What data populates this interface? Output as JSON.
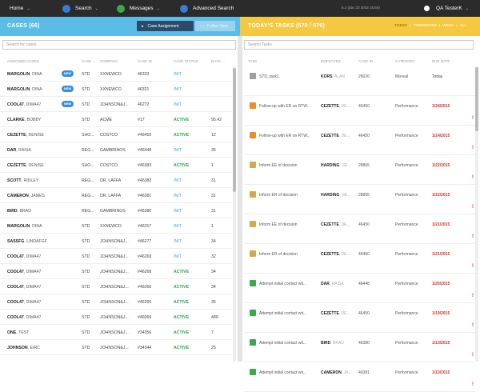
{
  "nav": {
    "home": "Home",
    "search": "Search",
    "messages": "Messages",
    "advanced": "Advanced Search",
    "version": "5.1 (abc 23 2015 15:50)",
    "user": "QA TesterK"
  },
  "cases": {
    "title": "CASES (66)",
    "assign_btn": "Case Assignment",
    "folder_btn": "Folder View",
    "search_placeholder": "Search for cases",
    "headers": [
      "ASSIGNED CASES",
      "CASE ...",
      "COMPANY",
      "CASE ID",
      "CASE STATUS",
      "DAYS ..."
    ],
    "rows": [
      {
        "last": "MARGOLIN",
        "first": ", DINA",
        "badge": "NEW",
        "type": "STD",
        "company": "XXNEWCO",
        "id": "46323",
        "status": "INIT",
        "days": ""
      },
      {
        "last": "MARGOLIN",
        "first": ", DINA",
        "badge": "NEW",
        "type": "STD",
        "company": "XXNEWCO",
        "id": "46321",
        "status": "INIT",
        "days": ""
      },
      {
        "last": "COOL47",
        "first": ", DIMA47",
        "badge": "NEW",
        "type": "STD",
        "company": "JOHNSON&J...",
        "id": "46272",
        "status": "INIT",
        "days": ""
      },
      {
        "last": "CLARKE",
        "first": ", BOBBY",
        "badge": "",
        "type": "STD",
        "company": "ACME",
        "id": "#17",
        "status": "ACTIVE",
        "days": "95.42"
      },
      {
        "last": "CEZETTE",
        "first": ", DENISE",
        "badge": "",
        "type": "SHO...",
        "company": "COSTCO",
        "id": "#46450",
        "status": "ACTIVE",
        "days": "12"
      },
      {
        "last": "DAR",
        "first": ", RAISA",
        "badge": "",
        "type": "REG...",
        "company": "GAMBRINOS",
        "id": "#46448",
        "status": "INIT",
        "days": "35"
      },
      {
        "last": "CEZETTE",
        "first": ", DENISE",
        "badge": "",
        "type": "SHO...",
        "company": "COSTCO",
        "id": "#46383",
        "status": "ACTIVE",
        "days": "1"
      },
      {
        "last": "SCOTT",
        "first": ", RIDLEY",
        "badge": "",
        "type": "REG...",
        "company": "DR. LAFFA",
        "id": "#46382",
        "status": "INIT",
        "days": "31"
      },
      {
        "last": "CAMERON",
        "first": ", JAMES",
        "badge": "",
        "type": "REG...",
        "company": "DR. LAFFA",
        "id": "#46381",
        "status": "INIT",
        "days": "31"
      },
      {
        "last": "BIRD",
        "first": ", BRAD",
        "badge": "",
        "type": "REG...",
        "company": "GAMBRINOS",
        "id": "#46380",
        "status": "INIT",
        "days": "31"
      },
      {
        "last": "MARGOLIN",
        "first": ", DINA",
        "badge": "",
        "type": "STD",
        "company": "XXNEWCO",
        "id": "#46317",
        "status": "INIT",
        "days": "1"
      },
      {
        "last": "SASSFG",
        "first": ", LINDAFGF",
        "badge": "",
        "type": "STD",
        "company": "JOHNSON&J...",
        "id": "#46277",
        "status": "INIT",
        "days": "34"
      },
      {
        "last": "COOL47",
        "first": ", DIMA47",
        "badge": "",
        "type": "STD",
        "company": "JOHNSON&J...",
        "id": "#46269",
        "status": "INIT",
        "days": "32"
      },
      {
        "last": "COOL47",
        "first": ", DIMA47",
        "badge": "",
        "type": "STD",
        "company": "JOHNSON&J...",
        "id": "#46268",
        "status": "ACTIVE",
        "days": "34"
      },
      {
        "last": "COOL47",
        "first": ", DIMA47",
        "badge": "",
        "type": "STD",
        "company": "JOHNSON&J...",
        "id": "#46266",
        "status": "ACTIVE",
        "days": "34"
      },
      {
        "last": "COOL47",
        "first": ", DIMA47",
        "badge": "",
        "type": "STD",
        "company": "JOHNSON&J...",
        "id": "#46265",
        "status": "ACTIVE",
        "days": "35"
      },
      {
        "last": "COOL47",
        "first": ", DIMA47",
        "badge": "",
        "type": "STD",
        "company": "JOHNSON&J...",
        "id": "#46069",
        "status": "ACTIVE",
        "days": "489"
      },
      {
        "last": "ONE",
        "first": ", TEST",
        "badge": "",
        "type": "STD",
        "company": "JOHNSON&J...",
        "id": "#34356",
        "status": "ACTIVE",
        "days": "7"
      },
      {
        "last": "JOHNSON",
        "first": ", EIRC",
        "badge": "",
        "type": "STD",
        "company": "JOHNSON&J...",
        "id": "#34344",
        "status": "ACTIVE",
        "days": "25"
      }
    ]
  },
  "tasks": {
    "title": "TODAY'S TASKS (570 / 576)",
    "filters": [
      "TODAY",
      "|",
      "TOMORROW",
      "|",
      "WEEK",
      "|",
      "ALL"
    ],
    "search_placeholder": "Search Tasks",
    "headers": [
      "TASK",
      "EMPLOYEE",
      "CASE ID",
      "CATEGORY",
      "DUE DATE"
    ],
    "rows": [
      {
        "icon": "gear-icon",
        "color": "#9e9e9e",
        "task": "STD_task1",
        "emp": "KORS",
        "empf": ", ALAN",
        "case": "26026",
        "cat": "Manual",
        "due": "Today",
        "overdue": false
      },
      {
        "icon": "document-icon",
        "color": "#f08a2b",
        "task": "Follow-up with ER on RTW...",
        "emp": "CEZETTE",
        "empf": ", DE...",
        "case": "46450",
        "cat": "Performance",
        "due": "1/24/2015",
        "overdue": true
      },
      {
        "icon": "document-icon",
        "color": "#f08a2b",
        "task": "Follow-up with ER on RTW...",
        "emp": "CEZETTE",
        "empf": ", DE...",
        "case": "46450",
        "cat": "Performance",
        "due": "1/24/2015",
        "overdue": true
      },
      {
        "icon": "gavel-icon",
        "color": "#d4a84b",
        "task": "Inform EE of decision",
        "emp": "HARDING",
        "empf": ", GE...",
        "case": "28865",
        "cat": "Performance",
        "due": "1/22/2015",
        "overdue": true
      },
      {
        "icon": "gavel-icon",
        "color": "#d4a84b",
        "task": "Inform ER of decision",
        "emp": "HARDING",
        "empf": ", GE...",
        "case": "28865",
        "cat": "Performance",
        "due": "1/22/2015",
        "overdue": true
      },
      {
        "icon": "gavel-icon",
        "color": "#d4a84b",
        "task": "Inform EE of decision",
        "emp": "CEZETTE",
        "empf": ", DE...",
        "case": "46450",
        "cat": "Performance",
        "due": "1/21/2015",
        "overdue": true
      },
      {
        "icon": "gavel-icon",
        "color": "#d4a84b",
        "task": "Inform ER of decision",
        "emp": "CEZETTE",
        "empf": ", DE...",
        "case": "46450",
        "cat": "Performance",
        "due": "1/21/2015",
        "overdue": true
      },
      {
        "icon": "phone-icon",
        "color": "#3aaa4a",
        "task": "Attempt initial contact wit...",
        "emp": "DAR",
        "empf": ", RAISA",
        "case": "46448",
        "cat": "Performance",
        "due": "1/20/2015",
        "overdue": true
      },
      {
        "icon": "phone-icon",
        "color": "#3aaa4a",
        "task": "Attempt initial contact wit...",
        "emp": "CEZETTE",
        "empf": ", DE...",
        "case": "46450",
        "cat": "Performance",
        "due": "1/19/2015",
        "overdue": true
      },
      {
        "icon": "phone-icon",
        "color": "#3aaa4a",
        "task": "Attempt initial contact wit...",
        "emp": "BIRD",
        "empf": ", BRAD",
        "case": "46380",
        "cat": "Performance",
        "due": "1/13/2015",
        "overdue": true
      },
      {
        "icon": "phone-icon",
        "color": "#3aaa4a",
        "task": "Attempt initial contact wit...",
        "emp": "CAMERON",
        "empf": ", JA...",
        "case": "46381",
        "cat": "Performance",
        "due": "1/13/2015",
        "overdue": true
      }
    ]
  },
  "colors": {
    "cases_header": "#5bbde6",
    "tasks_header": "#f5c842",
    "topbar": "#2b2b2b",
    "overdue": "#d0302a"
  }
}
